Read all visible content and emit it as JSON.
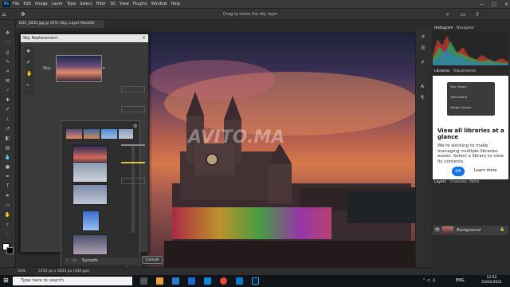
{
  "menu": {
    "items": [
      "File",
      "Edit",
      "Image",
      "Layer",
      "Type",
      "Select",
      "Filter",
      "3D",
      "View",
      "Plugins",
      "Window",
      "Help"
    ]
  },
  "window": {
    "minimize": "—",
    "maximize": "□",
    "close": "✕"
  },
  "options": {
    "hint": "Drag to move the sky layer"
  },
  "document": {
    "tab": "DSC_0045.jpg @ 50% (Sky, Layer Mask/8)",
    "zoom": "50%",
    "size": "5750 px x 3833 px (240 ppi)"
  },
  "dialog": {
    "title": "Sky Replacement",
    "sky_label": "Sky:",
    "folder": "Sunsets",
    "cancel": "Cancel",
    "close": "×"
  },
  "panels": {
    "histogram_tab": "Histogram",
    "navigator_tab": "Navigator",
    "libraries_tab": "Libraries",
    "adjustments_tab": "Adjustments",
    "libs_title": "View all libraries at a glance",
    "libs_body": "We're working to make managing multiple libraries easier. Select a library to view its contents.",
    "ok": "OK",
    "learn_more": "Learn more",
    "mock_items": [
      "Your Library",
      "Team Brand",
      "Design System"
    ],
    "layers_tab": "Layers",
    "channels_tab": "Channels",
    "paths_tab": "Paths",
    "layer_name": "Background"
  },
  "taskbar": {
    "search": "Type here to search",
    "lang": "ENG",
    "time": "12:52",
    "date": "23/02/2021"
  },
  "watermark": "AVITO.MA"
}
